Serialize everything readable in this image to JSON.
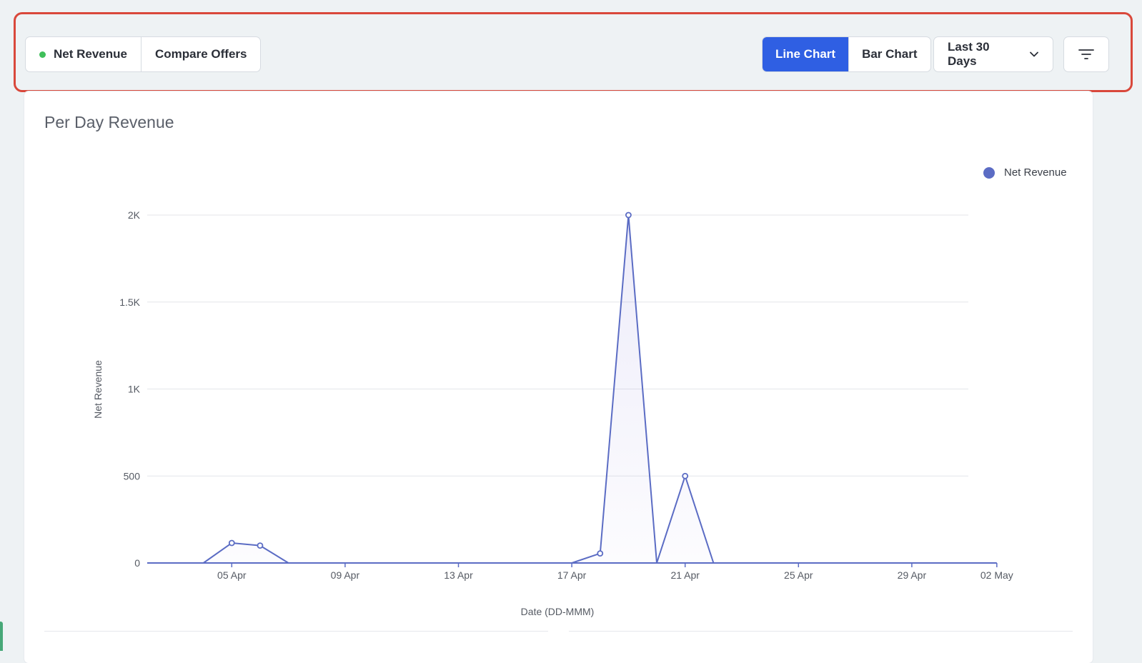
{
  "toolbar": {
    "metric_tabs": [
      {
        "label": "Net Revenue",
        "status_color": "#3fbf5a"
      },
      {
        "label": "Compare Offers"
      }
    ],
    "chart_types": [
      {
        "label": "Line Chart",
        "active": true
      },
      {
        "label": "Bar Chart",
        "active": false
      }
    ],
    "date_range": {
      "selected": "Last 30 Days",
      "icon": "chevron-down-icon"
    },
    "filter": {
      "icon": "filter-icon"
    },
    "highlight_color": "#d9483b",
    "accent_color": "#2f5fe3"
  },
  "card": {
    "title": "Per Day Revenue"
  },
  "chart_data": {
    "type": "line",
    "title": "Per Day Revenue",
    "xlabel": "Date (DD-MMM)",
    "ylabel": "Net Revenue",
    "ylim": [
      0,
      2000
    ],
    "y_ticks": [
      {
        "value": 0,
        "label": "0"
      },
      {
        "value": 500,
        "label": "500"
      },
      {
        "value": 1000,
        "label": "1K"
      },
      {
        "value": 1500,
        "label": "1.5K"
      },
      {
        "value": 2000,
        "label": "2K"
      }
    ],
    "x_ticks": [
      "05 Apr",
      "09 Apr",
      "13 Apr",
      "17 Apr",
      "21 Apr",
      "25 Apr",
      "29 Apr",
      "02 May"
    ],
    "grid": true,
    "legend_position": "top-right",
    "series": [
      {
        "name": "Net Revenue",
        "color": "#5b6cc4",
        "points": [
          {
            "x": "03 Apr",
            "y": 0
          },
          {
            "x": "04 Apr",
            "y": 0
          },
          {
            "x": "05 Apr",
            "y": 115,
            "marker": true
          },
          {
            "x": "06 Apr",
            "y": 100,
            "marker": true
          },
          {
            "x": "07 Apr",
            "y": 0
          },
          {
            "x": "08 Apr",
            "y": 0
          },
          {
            "x": "09 Apr",
            "y": 0
          },
          {
            "x": "10 Apr",
            "y": 0
          },
          {
            "x": "11 Apr",
            "y": 0
          },
          {
            "x": "12 Apr",
            "y": 0
          },
          {
            "x": "13 Apr",
            "y": 0
          },
          {
            "x": "14 Apr",
            "y": 0
          },
          {
            "x": "15 Apr",
            "y": 0
          },
          {
            "x": "16 Apr",
            "y": 0
          },
          {
            "x": "17 Apr",
            "y": 0
          },
          {
            "x": "18 Apr",
            "y": 55,
            "marker": true
          },
          {
            "x": "19 Apr",
            "y": 2000,
            "marker": true
          },
          {
            "x": "20 Apr",
            "y": 0
          },
          {
            "x": "21 Apr",
            "y": 500,
            "marker": true
          },
          {
            "x": "22 Apr",
            "y": 0
          },
          {
            "x": "23 Apr",
            "y": 0
          },
          {
            "x": "24 Apr",
            "y": 0
          },
          {
            "x": "25 Apr",
            "y": 0
          },
          {
            "x": "26 Apr",
            "y": 0
          },
          {
            "x": "27 Apr",
            "y": 0
          },
          {
            "x": "28 Apr",
            "y": 0
          },
          {
            "x": "29 Apr",
            "y": 0
          },
          {
            "x": "30 Apr",
            "y": 0
          },
          {
            "x": "01 May",
            "y": 0
          },
          {
            "x": "02 May",
            "y": 0
          }
        ]
      }
    ]
  }
}
